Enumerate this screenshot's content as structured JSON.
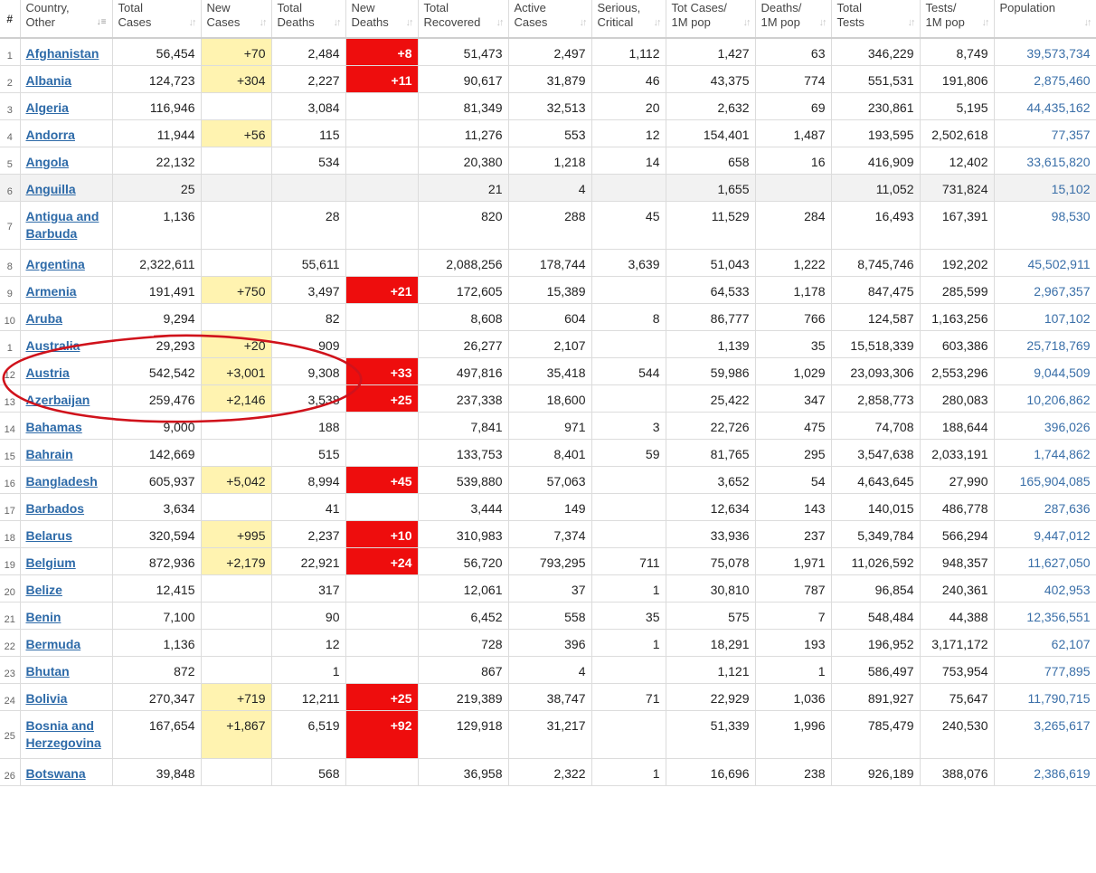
{
  "headers": [
    {
      "key": "rank",
      "label": "#"
    },
    {
      "key": "country",
      "label": "Country,\nOther"
    },
    {
      "key": "tc",
      "label": "Total\nCases"
    },
    {
      "key": "nc",
      "label": "New\nCases"
    },
    {
      "key": "td",
      "label": "Total\nDeaths"
    },
    {
      "key": "nd",
      "label": "New\nDeaths"
    },
    {
      "key": "tr",
      "label": "Total\nRecovered"
    },
    {
      "key": "ac",
      "label": "Active\nCases"
    },
    {
      "key": "sc",
      "label": "Serious,\nCritical"
    },
    {
      "key": "tcm",
      "label": "Tot Cases/\n1M pop"
    },
    {
      "key": "dm",
      "label": "Deaths/\n1M pop"
    },
    {
      "key": "tt",
      "label": "Total\nTests"
    },
    {
      "key": "tm",
      "label": "Tests/\n1M pop"
    },
    {
      "key": "pop",
      "label": "Population"
    }
  ],
  "rows": [
    {
      "rank": "1",
      "country": "Afghanistan",
      "tc": "56,454",
      "nc": "+70",
      "td": "2,484",
      "nd": "+8",
      "tr": "51,473",
      "ac": "2,497",
      "sc": "1,112",
      "tcm": "1,427",
      "dm": "63",
      "tt": "346,229",
      "tm": "8,749",
      "pop": "39,573,734"
    },
    {
      "rank": "2",
      "country": "Albania",
      "tc": "124,723",
      "nc": "+304",
      "td": "2,227",
      "nd": "+11",
      "tr": "90,617",
      "ac": "31,879",
      "sc": "46",
      "tcm": "43,375",
      "dm": "774",
      "tt": "551,531",
      "tm": "191,806",
      "pop": "2,875,460"
    },
    {
      "rank": "3",
      "country": "Algeria",
      "tc": "116,946",
      "nc": "",
      "td": "3,084",
      "nd": "",
      "tr": "81,349",
      "ac": "32,513",
      "sc": "20",
      "tcm": "2,632",
      "dm": "69",
      "tt": "230,861",
      "tm": "5,195",
      "pop": "44,435,162"
    },
    {
      "rank": "4",
      "country": "Andorra",
      "tc": "11,944",
      "nc": "+56",
      "td": "115",
      "nd": "",
      "tr": "11,276",
      "ac": "553",
      "sc": "12",
      "tcm": "154,401",
      "dm": "1,487",
      "tt": "193,595",
      "tm": "2,502,618",
      "pop": "77,357"
    },
    {
      "rank": "5",
      "country": "Angola",
      "tc": "22,132",
      "nc": "",
      "td": "534",
      "nd": "",
      "tr": "20,380",
      "ac": "1,218",
      "sc": "14",
      "tcm": "658",
      "dm": "16",
      "tt": "416,909",
      "tm": "12,402",
      "pop": "33,615,820"
    },
    {
      "rank": "6",
      "country": "Anguilla",
      "tc": "25",
      "nc": "",
      "td": "",
      "nd": "",
      "tr": "21",
      "ac": "4",
      "sc": "",
      "tcm": "1,655",
      "dm": "",
      "tt": "11,052",
      "tm": "731,824",
      "pop": "15,102",
      "grey": true
    },
    {
      "rank": "7",
      "country": "Antigua and Barbuda",
      "tc": "1,136",
      "nc": "",
      "td": "28",
      "nd": "",
      "tr": "820",
      "ac": "288",
      "sc": "45",
      "tcm": "11,529",
      "dm": "284",
      "tt": "16,493",
      "tm": "167,391",
      "pop": "98,530",
      "tall": true
    },
    {
      "rank": "8",
      "country": "Argentina",
      "tc": "2,322,611",
      "nc": "",
      "td": "55,611",
      "nd": "",
      "tr": "2,088,256",
      "ac": "178,744",
      "sc": "3,639",
      "tcm": "51,043",
      "dm": "1,222",
      "tt": "8,745,746",
      "tm": "192,202",
      "pop": "45,502,911"
    },
    {
      "rank": "9",
      "country": "Armenia",
      "tc": "191,491",
      "nc": "+750",
      "td": "3,497",
      "nd": "+21",
      "tr": "172,605",
      "ac": "15,389",
      "sc": "",
      "tcm": "64,533",
      "dm": "1,178",
      "tt": "847,475",
      "tm": "285,599",
      "pop": "2,967,357"
    },
    {
      "rank": "10",
      "country": "Aruba",
      "tc": "9,294",
      "nc": "",
      "td": "82",
      "nd": "",
      "tr": "8,608",
      "ac": "604",
      "sc": "8",
      "tcm": "86,777",
      "dm": "766",
      "tt": "124,587",
      "tm": "1,163,256",
      "pop": "107,102"
    },
    {
      "rank": "1",
      "country": "Australia",
      "tc": "29,293",
      "nc": "+20",
      "td": "909",
      "nd": "",
      "tr": "26,277",
      "ac": "2,107",
      "sc": "",
      "tcm": "1,139",
      "dm": "35",
      "tt": "15,518,339",
      "tm": "603,386",
      "pop": "25,718,769"
    },
    {
      "rank": "12",
      "country": "Austria",
      "tc": "542,542",
      "nc": "+3,001",
      "td": "9,308",
      "nd": "+33",
      "tr": "497,816",
      "ac": "35,418",
      "sc": "544",
      "tcm": "59,986",
      "dm": "1,029",
      "tt": "23,093,306",
      "tm": "2,553,296",
      "pop": "9,044,509"
    },
    {
      "rank": "13",
      "country": "Azerbaijan",
      "tc": "259,476",
      "nc": "+2,146",
      "td": "3,538",
      "nd": "+25",
      "tr": "237,338",
      "ac": "18,600",
      "sc": "",
      "tcm": "25,422",
      "dm": "347",
      "tt": "2,858,773",
      "tm": "280,083",
      "pop": "10,206,862"
    },
    {
      "rank": "14",
      "country": "Bahamas",
      "tc": "9,000",
      "nc": "",
      "td": "188",
      "nd": "",
      "tr": "7,841",
      "ac": "971",
      "sc": "3",
      "tcm": "22,726",
      "dm": "475",
      "tt": "74,708",
      "tm": "188,644",
      "pop": "396,026"
    },
    {
      "rank": "15",
      "country": "Bahrain",
      "tc": "142,669",
      "nc": "",
      "td": "515",
      "nd": "",
      "tr": "133,753",
      "ac": "8,401",
      "sc": "59",
      "tcm": "81,765",
      "dm": "295",
      "tt": "3,547,638",
      "tm": "2,033,191",
      "pop": "1,744,862"
    },
    {
      "rank": "16",
      "country": "Bangladesh",
      "tc": "605,937",
      "nc": "+5,042",
      "td": "8,994",
      "nd": "+45",
      "tr": "539,880",
      "ac": "57,063",
      "sc": "",
      "tcm": "3,652",
      "dm": "54",
      "tt": "4,643,645",
      "tm": "27,990",
      "pop": "165,904,085"
    },
    {
      "rank": "17",
      "country": "Barbados",
      "tc": "3,634",
      "nc": "",
      "td": "41",
      "nd": "",
      "tr": "3,444",
      "ac": "149",
      "sc": "",
      "tcm": "12,634",
      "dm": "143",
      "tt": "140,015",
      "tm": "486,778",
      "pop": "287,636"
    },
    {
      "rank": "18",
      "country": "Belarus",
      "tc": "320,594",
      "nc": "+995",
      "td": "2,237",
      "nd": "+10",
      "tr": "310,983",
      "ac": "7,374",
      "sc": "",
      "tcm": "33,936",
      "dm": "237",
      "tt": "5,349,784",
      "tm": "566,294",
      "pop": "9,447,012"
    },
    {
      "rank": "19",
      "country": "Belgium",
      "tc": "872,936",
      "nc": "+2,179",
      "td": "22,921",
      "nd": "+24",
      "tr": "56,720",
      "ac": "793,295",
      "sc": "711",
      "tcm": "75,078",
      "dm": "1,971",
      "tt": "11,026,592",
      "tm": "948,357",
      "pop": "11,627,050"
    },
    {
      "rank": "20",
      "country": "Belize",
      "tc": "12,415",
      "nc": "",
      "td": "317",
      "nd": "",
      "tr": "12,061",
      "ac": "37",
      "sc": "1",
      "tcm": "30,810",
      "dm": "787",
      "tt": "96,854",
      "tm": "240,361",
      "pop": "402,953"
    },
    {
      "rank": "21",
      "country": "Benin",
      "tc": "7,100",
      "nc": "",
      "td": "90",
      "nd": "",
      "tr": "6,452",
      "ac": "558",
      "sc": "35",
      "tcm": "575",
      "dm": "7",
      "tt": "548,484",
      "tm": "44,388",
      "pop": "12,356,551"
    },
    {
      "rank": "22",
      "country": "Bermuda",
      "tc": "1,136",
      "nc": "",
      "td": "12",
      "nd": "",
      "tr": "728",
      "ac": "396",
      "sc": "1",
      "tcm": "18,291",
      "dm": "193",
      "tt": "196,952",
      "tm": "3,171,172",
      "pop": "62,107"
    },
    {
      "rank": "23",
      "country": "Bhutan",
      "tc": "872",
      "nc": "",
      "td": "1",
      "nd": "",
      "tr": "867",
      "ac": "4",
      "sc": "",
      "tcm": "1,121",
      "dm": "1",
      "tt": "586,497",
      "tm": "753,954",
      "pop": "777,895"
    },
    {
      "rank": "24",
      "country": "Bolivia",
      "tc": "270,347",
      "nc": "+719",
      "td": "12,211",
      "nd": "+25",
      "tr": "219,389",
      "ac": "38,747",
      "sc": "71",
      "tcm": "22,929",
      "dm": "1,036",
      "tt": "891,927",
      "tm": "75,647",
      "pop": "11,790,715"
    },
    {
      "rank": "25",
      "country": "Bosnia and Herzegovina",
      "tc": "167,654",
      "nc": "+1,867",
      "td": "6,519",
      "nd": "+92",
      "tr": "129,918",
      "ac": "31,217",
      "sc": "",
      "tcm": "51,339",
      "dm": "1,996",
      "tt": "785,479",
      "tm": "240,530",
      "pop": "3,265,617",
      "tall": true
    },
    {
      "rank": "26",
      "country": "Botswana",
      "tc": "39,848",
      "nc": "",
      "td": "568",
      "nd": "",
      "tr": "36,958",
      "ac": "2,322",
      "sc": "1",
      "tcm": "16,696",
      "dm": "238",
      "tt": "926,189",
      "tm": "388,076",
      "pop": "2,386,619"
    }
  ],
  "colors": {
    "new_cases_highlight": "#fff3b0",
    "new_deaths_highlight": "#ee0d0d",
    "country_link": "#2d6aa8",
    "population_text": "#3a6fa8",
    "annotation_oval": "#d0121b"
  },
  "icons": {
    "sort": "sort-arrows-icon",
    "sort_active": "sort-desc-icon"
  }
}
